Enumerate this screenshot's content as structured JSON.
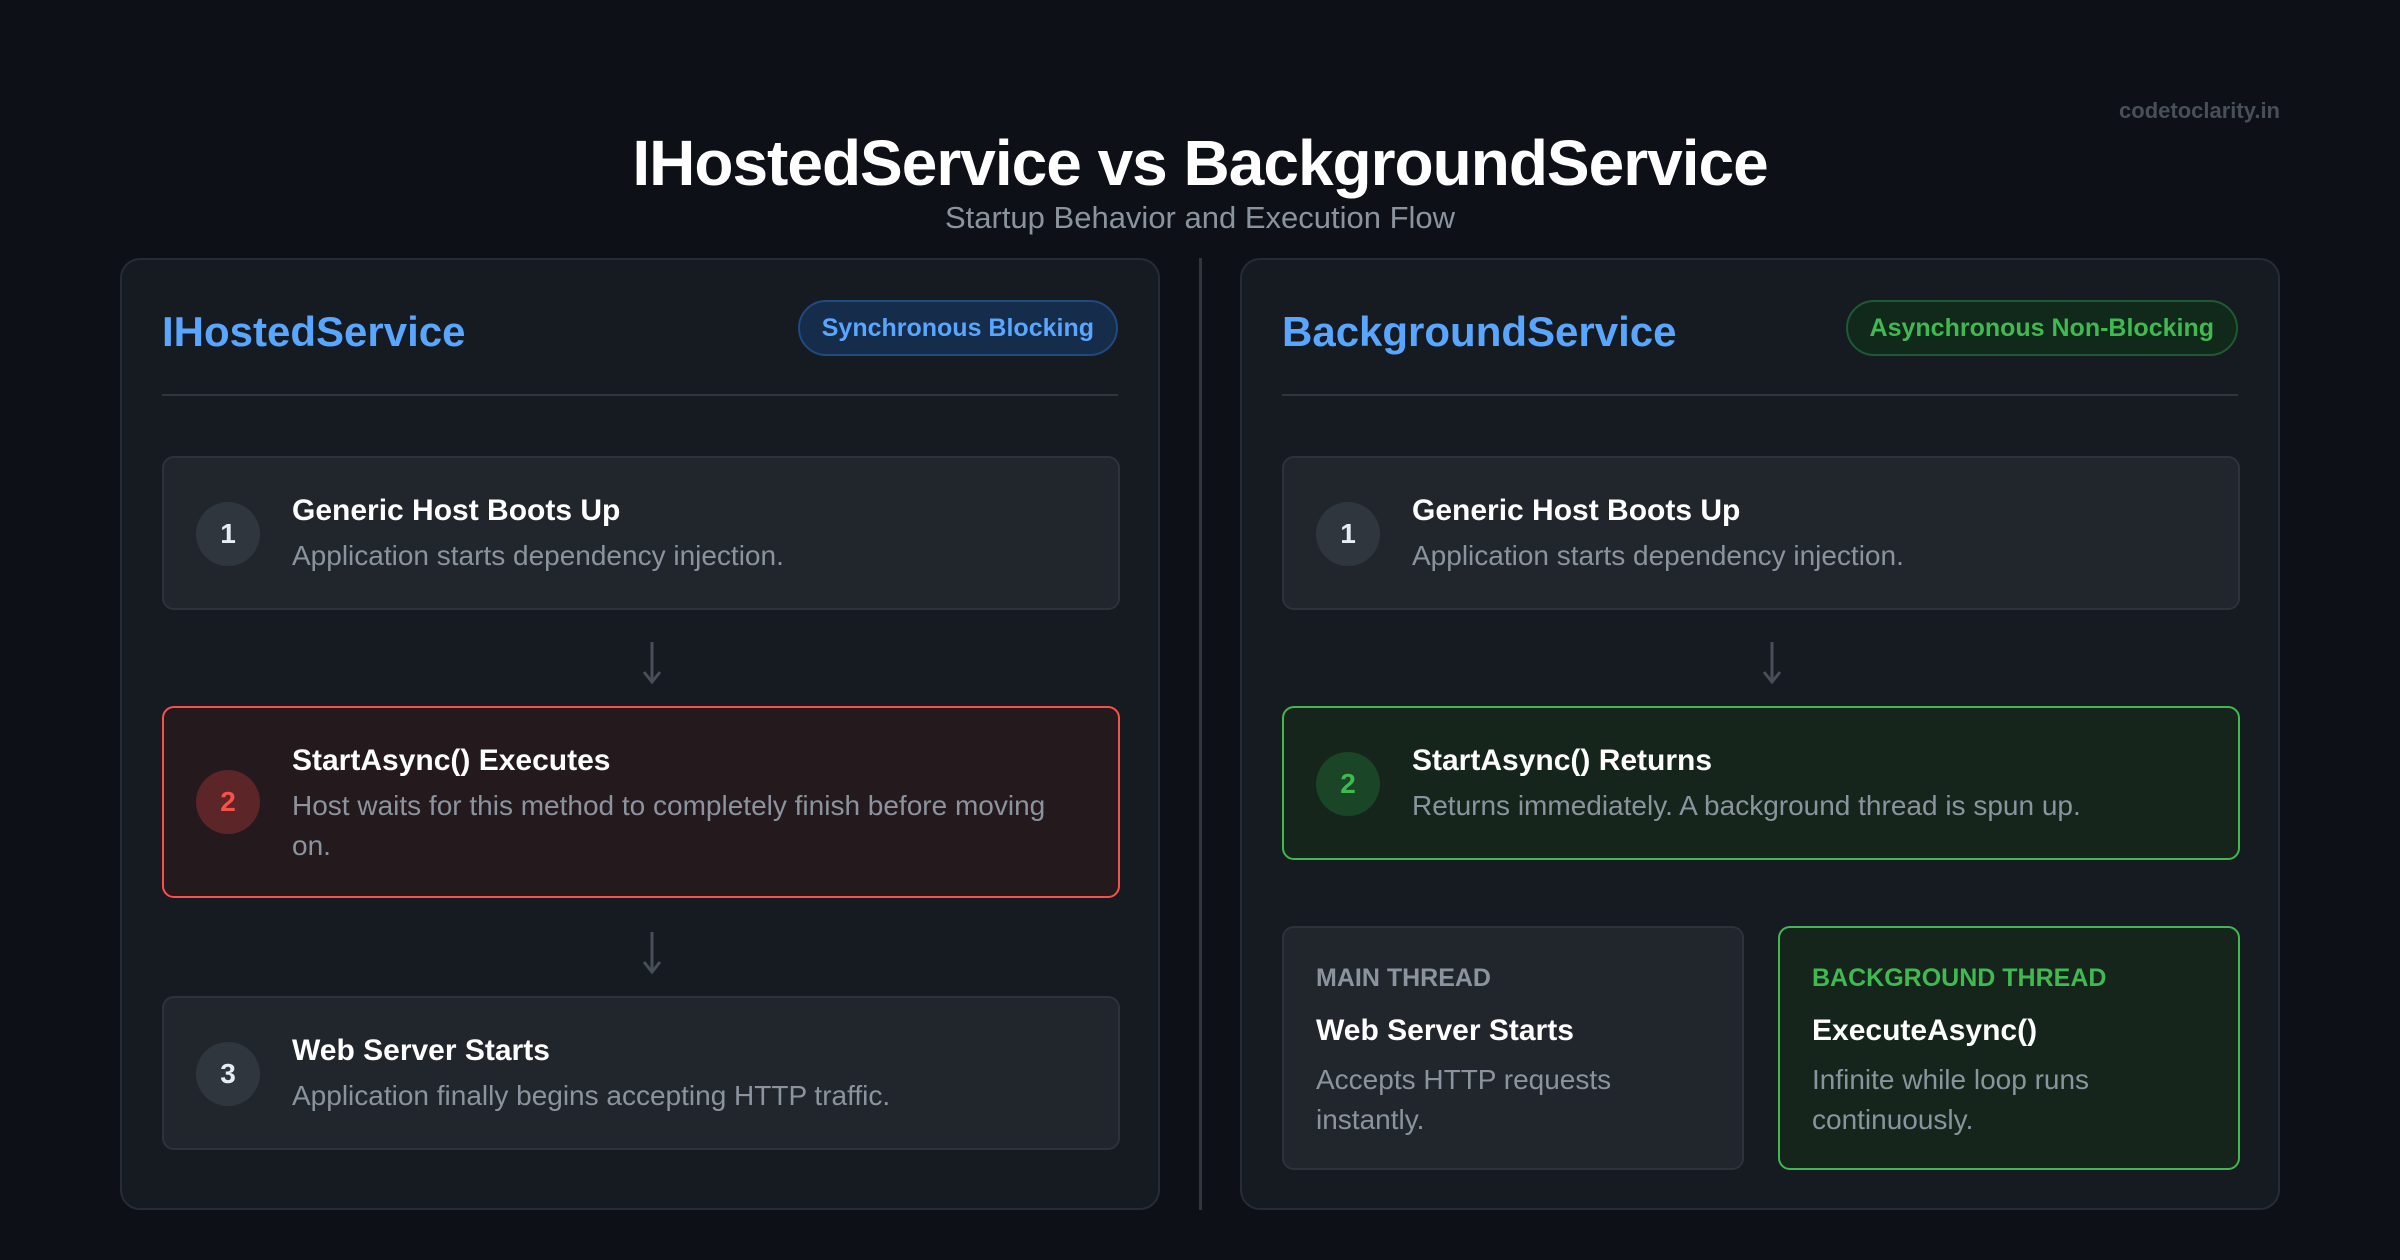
{
  "watermark": "codetoclarity.in",
  "title": "IHostedService vs BackgroundService",
  "subtitle": "Startup Behavior and Execution Flow",
  "colors": {
    "background": "#0d1117",
    "panel": "#161b22",
    "accent_blue": "#58a6ff",
    "accent_green": "#3fb950",
    "accent_red": "#f85149"
  },
  "left": {
    "title": "IHostedService",
    "badge": "Synchronous Blocking",
    "steps": [
      {
        "num": "1",
        "title": "Generic Host Boots Up",
        "desc": "Application starts dependency injection."
      },
      {
        "num": "2",
        "title": "StartAsync() Executes",
        "desc": "Host waits for this method to completely finish before moving on."
      },
      {
        "num": "3",
        "title": "Web Server Starts",
        "desc": "Application finally begins accepting HTTP traffic."
      }
    ]
  },
  "right": {
    "title": "BackgroundService",
    "badge": "Asynchronous Non-Blocking",
    "steps": [
      {
        "num": "1",
        "title": "Generic Host Boots Up",
        "desc": "Application starts dependency injection."
      },
      {
        "num": "2",
        "title": "StartAsync() Returns",
        "desc": "Returns immediately. A background thread is spun up."
      }
    ],
    "threads": [
      {
        "label": "MAIN THREAD",
        "title": "Web Server Starts",
        "desc": "Accepts HTTP requests instantly."
      },
      {
        "label": "BACKGROUND THREAD",
        "title": "ExecuteAsync()",
        "desc": "Infinite while loop runs continuously."
      }
    ]
  },
  "icons": [
    "arrow-down-icon"
  ]
}
